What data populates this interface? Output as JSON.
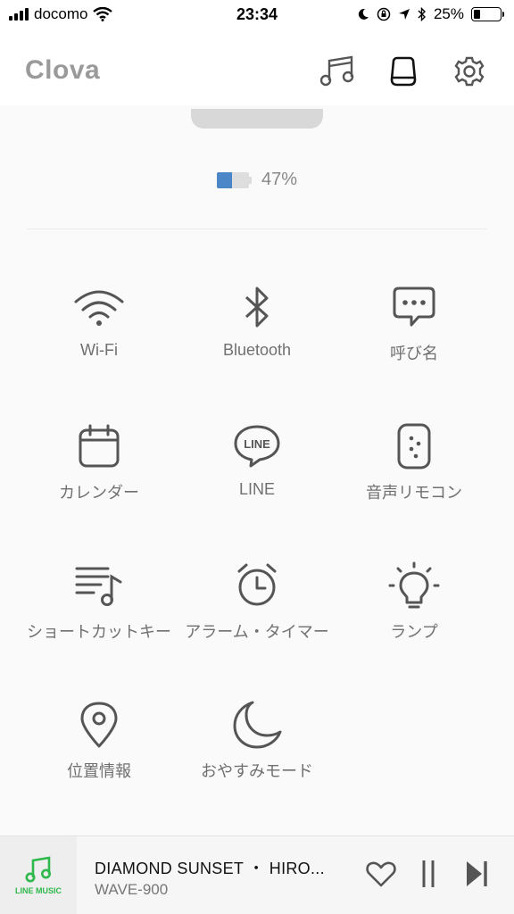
{
  "status_bar": {
    "carrier": "docomo",
    "time": "23:34",
    "battery_percent": "25%",
    "battery_level": 0.25
  },
  "header": {
    "title": "Clova",
    "icons": [
      "music-icon",
      "speaker-icon",
      "settings-icon"
    ]
  },
  "device": {
    "battery_text": "47%",
    "battery_level": 0.47,
    "battery_color": "#4a86c8"
  },
  "menu": {
    "items": [
      {
        "label": "Wi-Fi",
        "icon": "wifi-icon"
      },
      {
        "label": "Bluetooth",
        "icon": "bluetooth-icon"
      },
      {
        "label": "呼び名",
        "icon": "chat-bubble-icon"
      },
      {
        "label": "カレンダー",
        "icon": "calendar-icon"
      },
      {
        "label": "LINE",
        "icon": "line-icon"
      },
      {
        "label": "音声リモコン",
        "icon": "remote-icon"
      },
      {
        "label": "ショートカットキー",
        "icon": "playlist-icon"
      },
      {
        "label": "アラーム・タイマー",
        "icon": "alarm-clock-icon"
      },
      {
        "label": "ランプ",
        "icon": "lamp-icon"
      },
      {
        "label": "位置情報",
        "icon": "location-pin-icon"
      },
      {
        "label": "おやすみモード",
        "icon": "moon-icon"
      }
    ]
  },
  "player": {
    "service_label": "LINE MUSIC",
    "track": "DIAMOND SUNSET ・ HIRO...",
    "artist": "WAVE-900",
    "accent_color": "#2fb84b"
  }
}
